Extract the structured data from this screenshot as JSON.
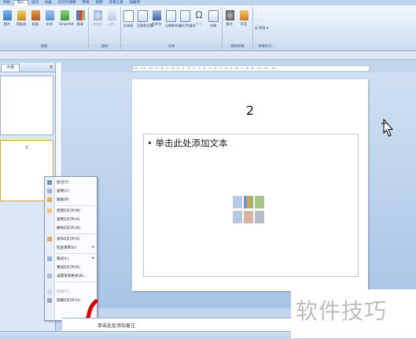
{
  "ribbon": {
    "tabs": [
      "开始",
      "插入",
      "设计",
      "动画",
      "幻灯片放映",
      "审阅",
      "视图",
      "开发工具",
      "加载项"
    ],
    "buttons": [
      "图片",
      "剪贴画",
      "相册",
      "形状",
      "SmartArt",
      "图表",
      "超链接",
      "动作",
      "文本框",
      "页眉和页脚",
      "艺术字",
      "日期和时间",
      "幻灯片编号",
      "符号",
      "对象",
      "影片",
      "声音"
    ],
    "small_group": {
      "omega_label": "Ω 符号 ▾"
    },
    "groups": [
      "插图",
      "链接",
      "文本",
      "媒体剪辑",
      "特殊符号"
    ]
  },
  "outline_panel": {
    "tab_label": "大纲",
    "close_symbol": "x",
    "slide_number": "2"
  },
  "ruler": {
    "marks": "·12· ·11· ·10· ·9· ·8· ·7· ·6· ·5· ·4· ·3· ·2· ·1· ·0· ·1· ·2· ·3· ·4· ·5· ·6· ·7· ·8· ·9· ·10· ·11· ·12·"
  },
  "slide": {
    "title": "2",
    "placeholder_text": "单击此处添加文本",
    "bullet": "•"
  },
  "context_menu": {
    "items": [
      {
        "label": "剪切(T)",
        "icon": "scissors-icon",
        "disabled": false
      },
      {
        "label": "复制(C)",
        "icon": "copy-icon",
        "disabled": false
      },
      {
        "label": "粘贴(P)",
        "icon": "paste-icon",
        "disabled": false
      },
      {
        "label": "新建幻灯片(N)",
        "icon": "new-slide-icon",
        "disabled": false
      },
      {
        "label": "复制幻灯片(A)",
        "icon": "duplicate-slide-icon",
        "disabled": false
      },
      {
        "label": "删除幻灯片(D)",
        "icon": "delete-slide-icon",
        "disabled": false
      },
      {
        "label": "发布幻灯片(S)",
        "icon": "publish-icon",
        "disabled": false
      },
      {
        "label": "检查更新(U)",
        "icon": "",
        "disabled": false,
        "submenu": true
      },
      {
        "label": "版式(L)",
        "icon": "layout-icon",
        "disabled": false,
        "submenu": true
      },
      {
        "label": "重设幻灯片(R)",
        "icon": "",
        "disabled": false
      },
      {
        "label": "设置背景格式(B)...",
        "icon": "background-icon",
        "disabled": false
      },
      {
        "label": "相册(P)...",
        "icon": "album-icon",
        "disabled": true
      },
      {
        "label": "隐藏幻灯片(H)",
        "icon": "hide-slide-icon",
        "disabled": false
      }
    ],
    "arrow": "▸"
  },
  "notes": {
    "placeholder": "单击此处添加备注"
  },
  "watermark": {
    "text": "软件技巧"
  },
  "colors": {
    "ribbon_blue": "#15428b",
    "redmark": "#d40000"
  }
}
